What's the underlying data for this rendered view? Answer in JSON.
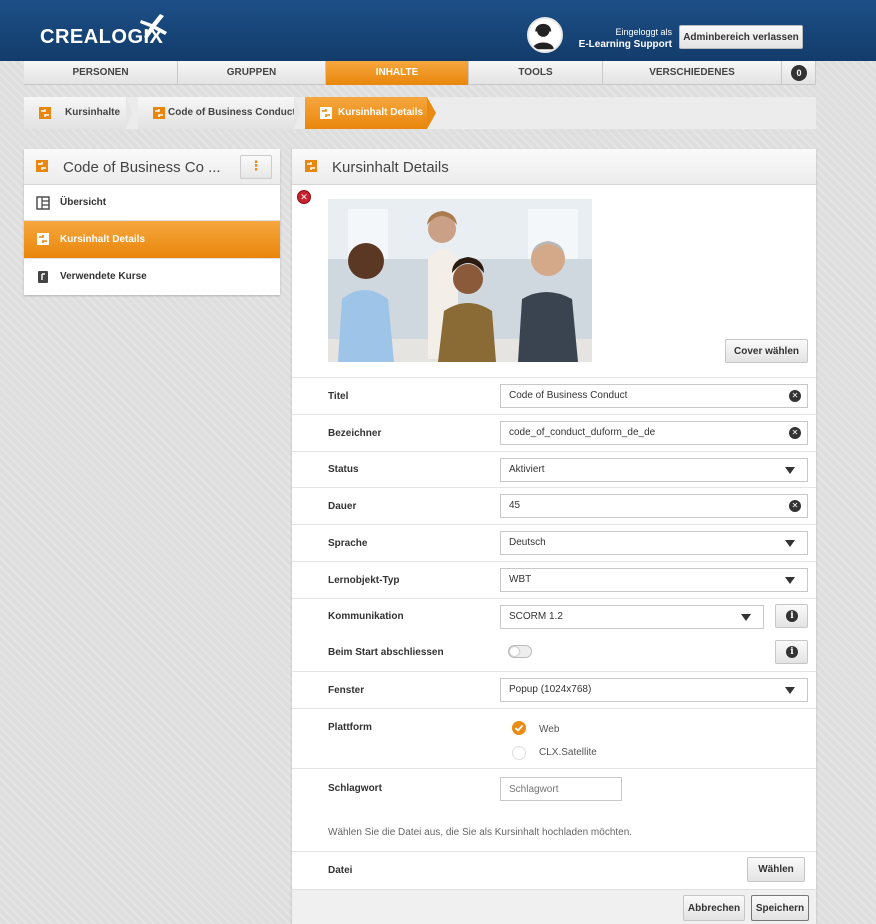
{
  "header": {
    "logo_text": "CREALOGIX",
    "logged_in_label": "Eingeloggt als",
    "logged_in_user": "E-Learning Support",
    "leave_admin_label": "Adminbereich verlassen"
  },
  "nav": {
    "items": [
      "PERSONEN",
      "GRUPPEN",
      "INHALTE",
      "TOOLS",
      "VERSCHIEDENES"
    ],
    "active": "INHALTE",
    "badge_count": "0"
  },
  "breadcrumb": {
    "items": [
      "Kursinhalte",
      "Code of Business Conduct",
      "Kursinhalt Details"
    ]
  },
  "sidebar": {
    "title": "Code of Business Co ...",
    "menu_icon": "more-vertical-icon",
    "items": [
      {
        "label": "Übersicht",
        "icon": "overview-icon"
      },
      {
        "label": "Kursinhalt Details",
        "icon": "content-icon"
      },
      {
        "label": "Verwendete Kurse",
        "icon": "course-icon"
      }
    ],
    "active": "Kursinhalt Details"
  },
  "main": {
    "title": "Kursinhalt Details",
    "cover_button": "Cover wählen",
    "fields": {
      "titel": {
        "label": "Titel",
        "value": "Code of Business Conduct"
      },
      "bezeichner": {
        "label": "Bezeichner",
        "value": "code_of_conduct_duform_de_de"
      },
      "status": {
        "label": "Status",
        "value": "Aktiviert"
      },
      "dauer": {
        "label": "Dauer",
        "value": "45"
      },
      "sprache": {
        "label": "Sprache",
        "value": "Deutsch"
      },
      "lernobjekt_typ": {
        "label": "Lernobjekt-Typ",
        "value": "WBT"
      },
      "kommunikation": {
        "label": "Kommunikation",
        "value": "SCORM 1.2"
      },
      "beim_start": {
        "label": "Beim Start abschliessen",
        "enabled": false
      },
      "fenster": {
        "label": "Fenster",
        "value": "Popup (1024x768)"
      },
      "plattform": {
        "label": "Plattform",
        "options": [
          {
            "label": "Web",
            "checked": true
          },
          {
            "label": "CLX.Satellite",
            "checked": false
          }
        ]
      },
      "schlagwort": {
        "label": "Schlagwort",
        "placeholder": "Schlagwort"
      },
      "datei": {
        "label": "Datei",
        "hint": "Wählen Sie die Datei aus, die Sie als Kursinhalt hochladen möchten.",
        "button": "Wählen"
      }
    },
    "cancel_button": "Abbrechen",
    "save_button": "Speichern"
  },
  "colors": {
    "brand_blue": "#1a4a80",
    "accent_orange": "#ec8b14"
  }
}
